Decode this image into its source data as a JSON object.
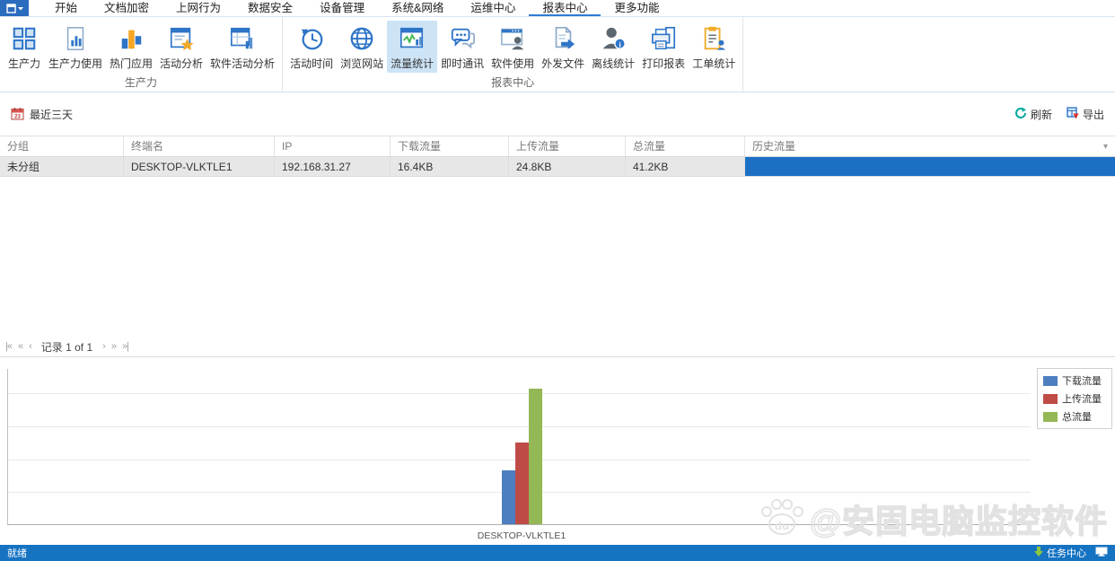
{
  "menu": {
    "tabs": [
      {
        "label": "开始"
      },
      {
        "label": "文档加密"
      },
      {
        "label": "上网行为"
      },
      {
        "label": "数据安全"
      },
      {
        "label": "设备管理"
      },
      {
        "label": "系统&网络"
      },
      {
        "label": "运维中心"
      },
      {
        "label": "报表中心"
      },
      {
        "label": "更多功能"
      }
    ],
    "selected_tab": "报表中心"
  },
  "ribbon": {
    "groups": [
      {
        "label": "生产力",
        "buttons": [
          {
            "label": "生产力",
            "icon": "grid-icon"
          },
          {
            "label": "生产力使用",
            "icon": "document-chart-icon"
          },
          {
            "label": "热门应用",
            "icon": "hot-apps-bars-icon"
          },
          {
            "label": "活动分析",
            "icon": "document-star-icon"
          },
          {
            "label": "软件活动分析",
            "icon": "window-analysis-icon"
          }
        ]
      },
      {
        "label": "报表中心",
        "buttons": [
          {
            "label": "活动时间",
            "icon": "clock-history-icon"
          },
          {
            "label": "浏览网站",
            "icon": "globe-icon"
          },
          {
            "label": "流量统计",
            "icon": "traffic-stats-icon",
            "selected": true
          },
          {
            "label": "即时通讯",
            "icon": "chat-icon"
          },
          {
            "label": "软件使用",
            "icon": "window-user-icon"
          },
          {
            "label": "外发文件",
            "icon": "file-send-icon"
          },
          {
            "label": "离线统计",
            "icon": "user-info-icon"
          },
          {
            "label": "打印报表",
            "icon": "printer-icon"
          },
          {
            "label": "工单统计",
            "icon": "clipboard-user-icon"
          }
        ]
      }
    ]
  },
  "toolbar": {
    "date_filter_label": "最近三天",
    "refresh_label": "刷新",
    "export_label": "导出"
  },
  "table": {
    "columns": [
      "分组",
      "终端名",
      "IP",
      "下载流量",
      "上传流量",
      "总流量",
      "历史流量"
    ],
    "rows": [
      {
        "group": "未分组",
        "terminal": "DESKTOP-VLKTLE1",
        "ip": "192.168.31.27",
        "download": "16.4KB",
        "upload": "24.8KB",
        "total": "41.2KB"
      }
    ]
  },
  "pagination": {
    "first": "|«",
    "prev_group": "«",
    "prev": "‹",
    "label": "记录 1 of 1",
    "next": "›",
    "next_group": "»",
    "last": "»|"
  },
  "chart_data": {
    "type": "bar",
    "categories": [
      "DESKTOP-VLKTLE1"
    ],
    "series": [
      {
        "name": "下载流量",
        "values": [
          16.4
        ],
        "color": "#4d7ebf"
      },
      {
        "name": "上传流量",
        "values": [
          24.8
        ],
        "color": "#bf4b47"
      },
      {
        "name": "总流量",
        "values": [
          41.2
        ],
        "color": "#94b855"
      }
    ],
    "unit": "KB",
    "title": "",
    "xlabel": "",
    "ylabel": "",
    "ylim": [
      0,
      47.5
    ],
    "gridline_step": 10,
    "grid": true,
    "legend_position": "top-right"
  },
  "watermark": {
    "badge": "du",
    "text": "@安固电脑监控软件"
  },
  "status_bar": {
    "left": "就绪",
    "task_center_label": "任务中心"
  },
  "colors": {
    "accent_blue": "#1673c2",
    "history_bar": "#1b6fc4",
    "selected_ribbon_bg": "#cde4f7",
    "bar_blue": "#4d7ebf",
    "bar_red": "#bf4b47",
    "bar_green": "#94b855"
  }
}
